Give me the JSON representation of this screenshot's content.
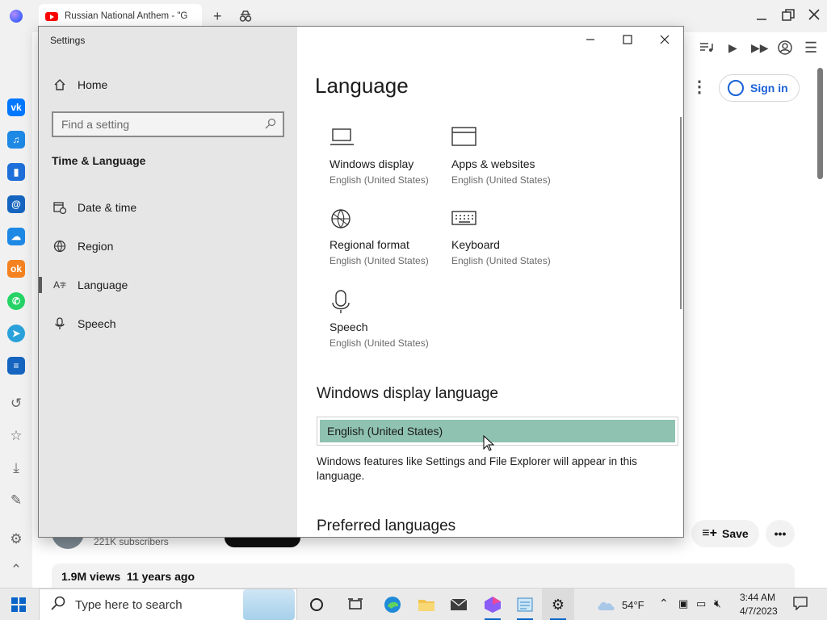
{
  "browser": {
    "tab_title": "Russian National Anthem - \"G",
    "signin_label": "Sign in",
    "subscribers": "221K subscribers",
    "views": "1.9M views  11 years ago",
    "save_label": "Save"
  },
  "settings": {
    "window_title": "Settings",
    "nav": {
      "home": "Home",
      "search_placeholder": "Find a setting",
      "section": "Time & Language",
      "items": [
        {
          "label": "Date & time",
          "icon": "calendar-clock-icon"
        },
        {
          "label": "Region",
          "icon": "globe-icon"
        },
        {
          "label": "Language",
          "icon": "language-icon"
        },
        {
          "label": "Speech",
          "icon": "microphone-icon"
        }
      ]
    },
    "content": {
      "heading": "Language",
      "tiles": [
        {
          "name": "Windows display",
          "sub": "English (United States)",
          "icon": "laptop-icon"
        },
        {
          "name": "Apps & websites",
          "sub": "English (United States)",
          "icon": "window-icon"
        },
        {
          "name": "Regional format",
          "sub": "English (United States)",
          "icon": "regional-globe-icon"
        },
        {
          "name": "Keyboard",
          "sub": "English (United States)",
          "icon": "keyboard-icon"
        },
        {
          "name": "Speech",
          "sub": "English (United States)",
          "icon": "microphone-icon"
        }
      ],
      "display_language_heading": "Windows display language",
      "display_language_value": "English (United States)",
      "display_language_desc": "Windows features like Settings and File Explorer will appear in this language.",
      "preferred_heading": "Preferred languages"
    }
  },
  "taskbar": {
    "search_placeholder": "Type here to search",
    "weather": "54°F",
    "time": "3:44 AM",
    "date": "4/7/2023"
  },
  "colors": {
    "accent_selected": "#8fc2b0",
    "nav_bg": "#e6e6e6",
    "windows_blue": "#0a64c8"
  }
}
